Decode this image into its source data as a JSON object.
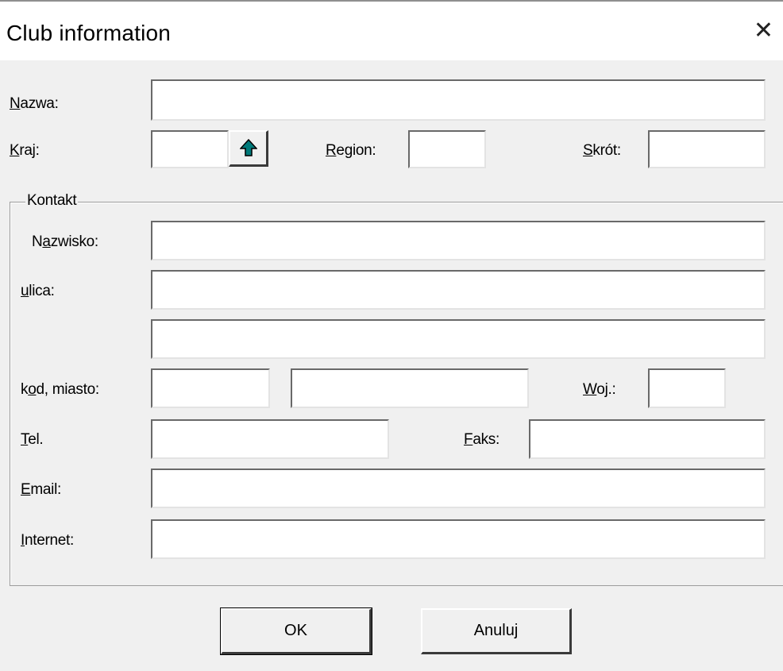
{
  "window": {
    "title": "Club information",
    "close_glyph": "✕"
  },
  "form": {
    "nazwa": {
      "label_u": "N",
      "label_rest": "azwa:",
      "value": ""
    },
    "kraj": {
      "label_u": "K",
      "label_rest": "raj:",
      "value": ""
    },
    "region": {
      "label_u": "R",
      "label_rest": "egion:",
      "value": ""
    },
    "skrot": {
      "label_u": "S",
      "label_rest": "krót:",
      "value": ""
    }
  },
  "contact": {
    "legend": "Kontakt",
    "nazwisko": {
      "label_pre": "N",
      "label_u": "a",
      "label_rest": "zwisko:",
      "value": ""
    },
    "ulica": {
      "label_u": "u",
      "label_rest": "lica:",
      "value": "",
      "value2": ""
    },
    "kod": {
      "label_pre": "k",
      "label_u": "o",
      "label_rest": "d, miasto:",
      "kod_value": "",
      "miasto_value": ""
    },
    "woj": {
      "label_u": "W",
      "label_rest": "oj.:",
      "value": ""
    },
    "tel": {
      "label_u": "T",
      "label_rest": "el.",
      "value": ""
    },
    "faks": {
      "label_u": "F",
      "label_rest": "aks:",
      "value": ""
    },
    "email": {
      "label_u": "E",
      "label_rest": "mail:",
      "value": ""
    },
    "internet": {
      "label_u": "I",
      "label_rest": "nternet:",
      "value": ""
    }
  },
  "buttons": {
    "ok": "OK",
    "cancel": "Anuluj"
  },
  "icons": {
    "arrow": "arrow-up-icon",
    "arrow_color": "#007a7a"
  }
}
